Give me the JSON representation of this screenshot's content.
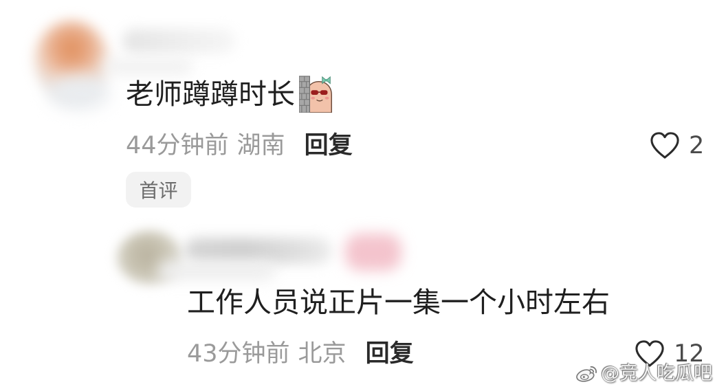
{
  "comments": [
    {
      "text": "老师蹲蹲时长",
      "sticker_icon": "peeking-behind-wall-sticker",
      "time": "44分钟前",
      "location": "湖南",
      "reply_label": "回复",
      "like_count": "2",
      "badge": "首评"
    },
    {
      "text": "工作人员说正片一集一个小时左右",
      "time": "43分钟前",
      "location": "北京",
      "reply_label": "回复",
      "like_count": "12"
    }
  ],
  "icons": {
    "like": "heart-outline-icon",
    "watermark_logo": "weibo-icon"
  },
  "watermark": {
    "text": "@竞人吃瓜吧"
  },
  "colors": {
    "background": "#ffffff",
    "primary_text": "#1f1f1f",
    "secondary_text": "#9a9a9a",
    "reply_text": "#2a2a2a",
    "badge_background": "#f2f2f2",
    "badge_text": "#6b6b6b",
    "icon_stroke": "#2b2b2b"
  }
}
